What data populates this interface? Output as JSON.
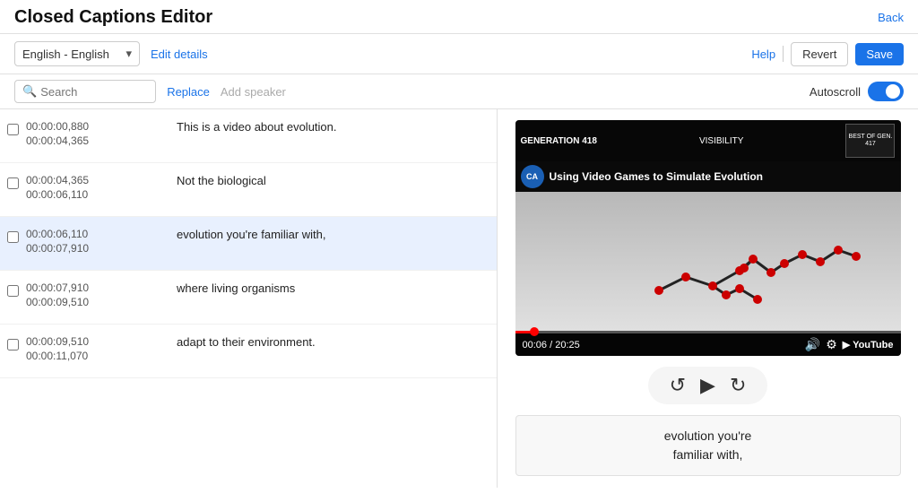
{
  "header": {
    "title": "Closed Captions Editor",
    "back_label": "Back"
  },
  "toolbar": {
    "language": "English - English",
    "edit_details_label": "Edit details",
    "help_label": "Help",
    "revert_label": "Revert",
    "save_label": "Save"
  },
  "searchbar": {
    "search_placeholder": "Search",
    "replace_label": "Replace",
    "add_speaker_label": "Add speaker",
    "autoscroll_label": "Autoscroll"
  },
  "captions": [
    {
      "start": "00:00:00,880",
      "end": "00:00:04,365",
      "text": "This is a video about evolution.",
      "highlighted": false
    },
    {
      "start": "00:00:04,365",
      "end": "00:00:06,110",
      "text": "Not the biological",
      "highlighted": false
    },
    {
      "start": "00:00:06,110",
      "end": "00:00:07,910",
      "text": "evolution you're familiar with,",
      "highlighted": true
    },
    {
      "start": "00:00:07,910",
      "end": "00:00:09,510",
      "text": "where living organisms",
      "highlighted": false
    },
    {
      "start": "00:00:09,510",
      "end": "00:00:11,070",
      "text": "adapt to their environment.",
      "highlighted": false
    }
  ],
  "video": {
    "gen_label": "GENERATION 418",
    "visibility_label": "VISIBILITY",
    "best_label": "BEST OF GEN. 417",
    "ca_logo": "CA",
    "title": "Using Video Games to Simulate Evolution",
    "time_current": "00:06",
    "time_total": "20:25",
    "progress_pct": 5
  },
  "caption_display": {
    "line1": "evolution you're",
    "line2": "familiar with,"
  },
  "controls": {
    "rewind_icon": "↺",
    "play_icon": "▶",
    "forward_icon": "↻"
  }
}
